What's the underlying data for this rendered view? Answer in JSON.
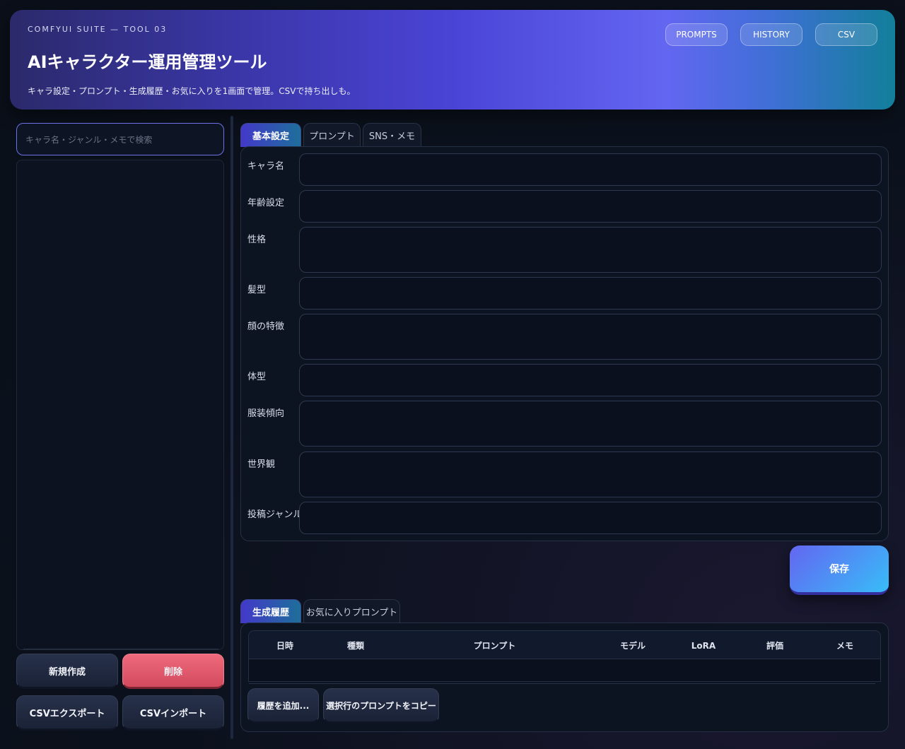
{
  "header": {
    "eyebrow": "COMFYUI SUITE — TOOL 03",
    "title": "AIキャラクター運用管理ツール",
    "subtitle": "キャラ設定・プロンプト・生成履歴・お気に入りを1画面で管理。CSVで持ち出しも。",
    "nav": [
      "PROMPTS",
      "HISTORY",
      "CSV"
    ]
  },
  "sidebar": {
    "search_placeholder": "キャラ名・ジャンル・メモで検索",
    "buttons": {
      "new": "新規作成",
      "delete": "削除",
      "csv_export": "CSVエクスポート",
      "csv_import": "CSVインポート"
    }
  },
  "editor": {
    "tabs": [
      "基本設定",
      "プロンプト",
      "SNS・メモ"
    ],
    "active_tab": "基本設定",
    "fields": [
      "キャラ名",
      "年齢設定",
      "性格",
      "髪型",
      "顔の特徴",
      "体型",
      "服装傾向",
      "世界観",
      "投稿ジャンル"
    ],
    "save_label": "保存"
  },
  "history": {
    "tabs": [
      "生成履歴",
      "お気に入りプロンプト"
    ],
    "active_tab": "生成履歴",
    "columns": [
      "日時",
      "種類",
      "プロンプト",
      "モデル",
      "LoRA",
      "評価",
      "メモ"
    ],
    "rows": [],
    "buttons": {
      "add": "履歴を追加...",
      "copy": "選択行のプロンプトをコピー"
    }
  },
  "colors": {
    "accent": "#6366f1",
    "accent_cyan": "#38bdf8",
    "danger": "#e05a6d",
    "background": "#0b111c"
  }
}
